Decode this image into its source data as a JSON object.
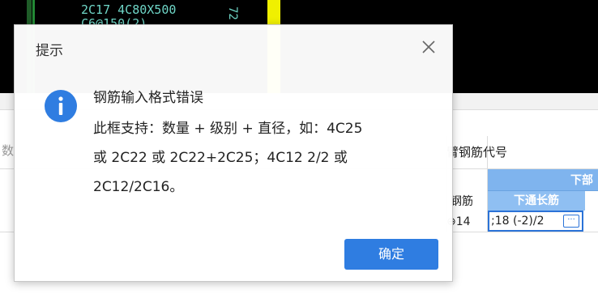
{
  "cad": {
    "text_lines": "2C17 4C80X500\nC6@150(2)",
    "vertical_text": "72"
  },
  "grid": {
    "left_label": "数",
    "header_code": "臂钢筋代号",
    "group_header": "下部",
    "column_label": "钢筋",
    "column_sub_header": "下通长筋",
    "row_value": "⁢14",
    "row_value_display": "⊕14",
    "edit_value": ";18 (-2)/2",
    "ellipsis_label": "···"
  },
  "dialog": {
    "title": "提示",
    "message_title": "钢筋输入格式错误",
    "message_lines": [
      "此框支持：数量 + 级别 + 直径，如：4C25",
      "或 2C22 或 2C22+2C25；4C12 2/2 或",
      "2C12/2C16。"
    ],
    "ok_label": "确定"
  },
  "colors": {
    "accent": "#2f7de1",
    "info_icon": "#2f7de1",
    "header_blue": "#7fb4ee"
  },
  "icons": {
    "close": "close-icon",
    "info": "info-icon",
    "ellipsis": "ellipsis-icon"
  }
}
